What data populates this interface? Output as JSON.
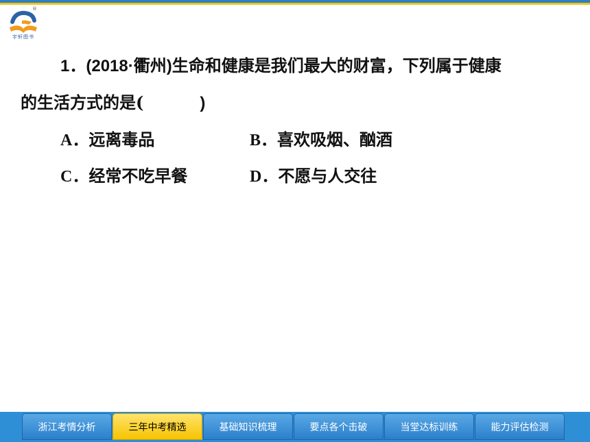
{
  "logo": {
    "caption": "宇轩图书",
    "registered": "®"
  },
  "question": {
    "number": "1．",
    "source": "(2018·衢州)",
    "line1_text": "生命和健康是我们最大的财富，下列属于健康",
    "line2_text": "的生活方式的是(",
    "line2_close": ")"
  },
  "options": [
    {
      "letter": "A．",
      "text": "远离毒品"
    },
    {
      "letter": "B．",
      "text": "喜欢吸烟、酗酒"
    },
    {
      "letter": "C．",
      "text": "经常不吃早餐"
    },
    {
      "letter": "D．",
      "text": "不愿与人交往"
    }
  ],
  "tabs": [
    {
      "label": "浙江考情分析"
    },
    {
      "label": "三年中考精选"
    },
    {
      "label": "基础知识梳理"
    },
    {
      "label": "要点各个击破"
    },
    {
      "label": "当堂达标训练"
    },
    {
      "label": "能力评估检测"
    }
  ],
  "active_tab_index": 1,
  "colors": {
    "accent_blue": "#2f8fd6",
    "active_tab": "#f6c400",
    "top_bar_yellow": "#f0c419"
  }
}
